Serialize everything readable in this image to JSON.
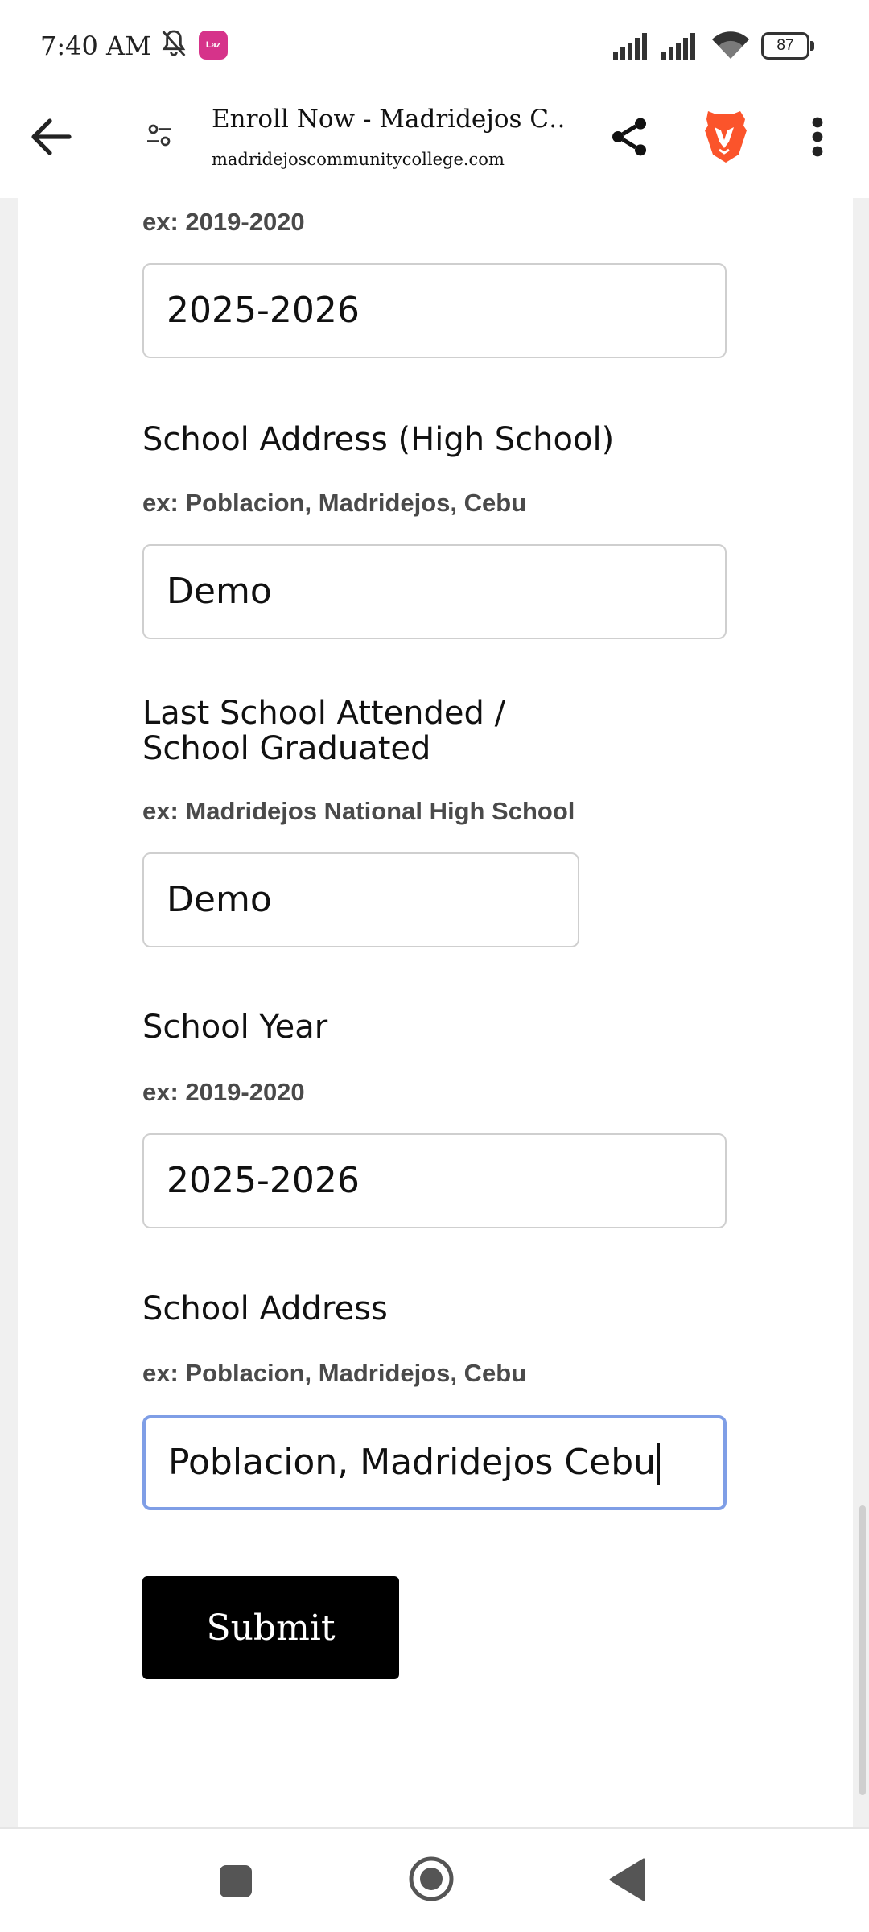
{
  "status_bar": {
    "time": "7:40 AM",
    "app_badge": "Laz",
    "battery": "87"
  },
  "browser": {
    "tab_title": "Enroll Now - Madridejos C…",
    "url": "madridejoscommunitycollege.com"
  },
  "form": {
    "top_hint": "ex: 2019-2020",
    "top_input_value": "2025-2026",
    "hs_address_label": "School Address (High School)",
    "hs_address_hint": "ex: Poblacion, Madridejos, Cebu",
    "hs_address_value": "Demo",
    "last_school_label_line1": "Last School Attended /",
    "last_school_label_line2": "School Graduated",
    "last_school_hint": "ex: Madridejos National High School",
    "last_school_value": "Demo",
    "school_year_label": "School Year",
    "school_year_hint": "ex: 2019-2020",
    "school_year_value": "2025-2026",
    "school_address_label": "School Address",
    "school_address_hint": "ex: Poblacion, Madridejos, Cebu",
    "school_address_value": "Poblacion, Madridejos Cebu",
    "submit_label": "Submit"
  },
  "colors": {
    "focus_border": "#7f9ee6",
    "brave_orange": "#fb542b",
    "badge_pink": "#d6338a"
  },
  "icons": {
    "status": [
      "bell-off-icon",
      "app-badge-icon",
      "signal-icon",
      "signal-icon",
      "wifi-icon",
      "battery-icon"
    ],
    "toolbar": [
      "back-arrow-icon",
      "site-settings-icon",
      "share-icon",
      "brave-lion-icon",
      "more-vert-icon"
    ],
    "nav": [
      "recents-icon",
      "home-icon",
      "back-triangle-icon"
    ]
  }
}
